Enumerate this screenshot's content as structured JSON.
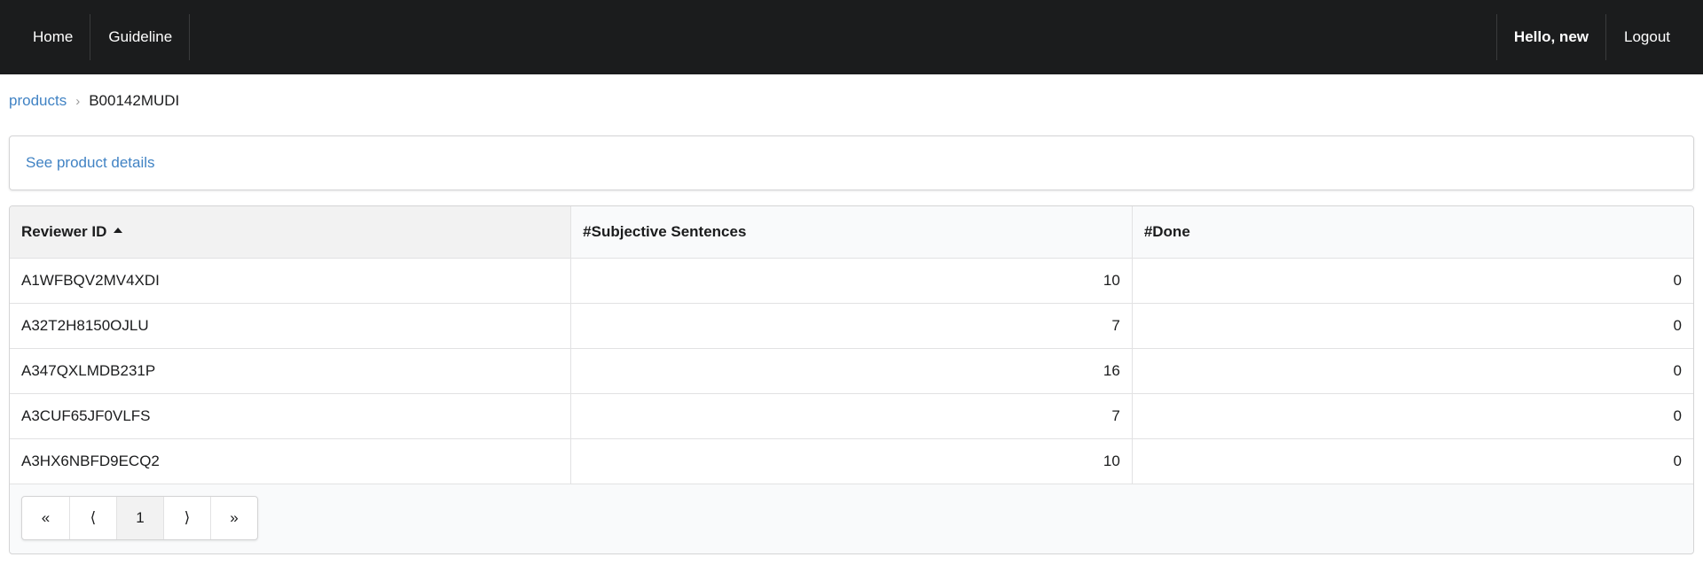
{
  "nav": {
    "home": "Home",
    "guideline": "Guideline",
    "greeting": "Hello, new",
    "logout": "Logout"
  },
  "breadcrumb": {
    "parent": "products",
    "current": "B00142MUDI"
  },
  "details": {
    "link": "See product details"
  },
  "table": {
    "headers": [
      "Reviewer ID",
      "#Subjective Sentences",
      "#Done"
    ],
    "rows": [
      [
        "A1WFBQV2MV4XDI",
        "10",
        "0"
      ],
      [
        "A32T2H8150OJLU",
        "7",
        "0"
      ],
      [
        "A347QXLMDB231P",
        "16",
        "0"
      ],
      [
        "A3CUF65JF0VLFS",
        "7",
        "0"
      ],
      [
        "A3HX6NBFD9ECQ2",
        "10",
        "0"
      ]
    ]
  },
  "pagination": {
    "first": "«",
    "prev": "⟨",
    "current": "1",
    "next": "⟩",
    "last": "»"
  }
}
